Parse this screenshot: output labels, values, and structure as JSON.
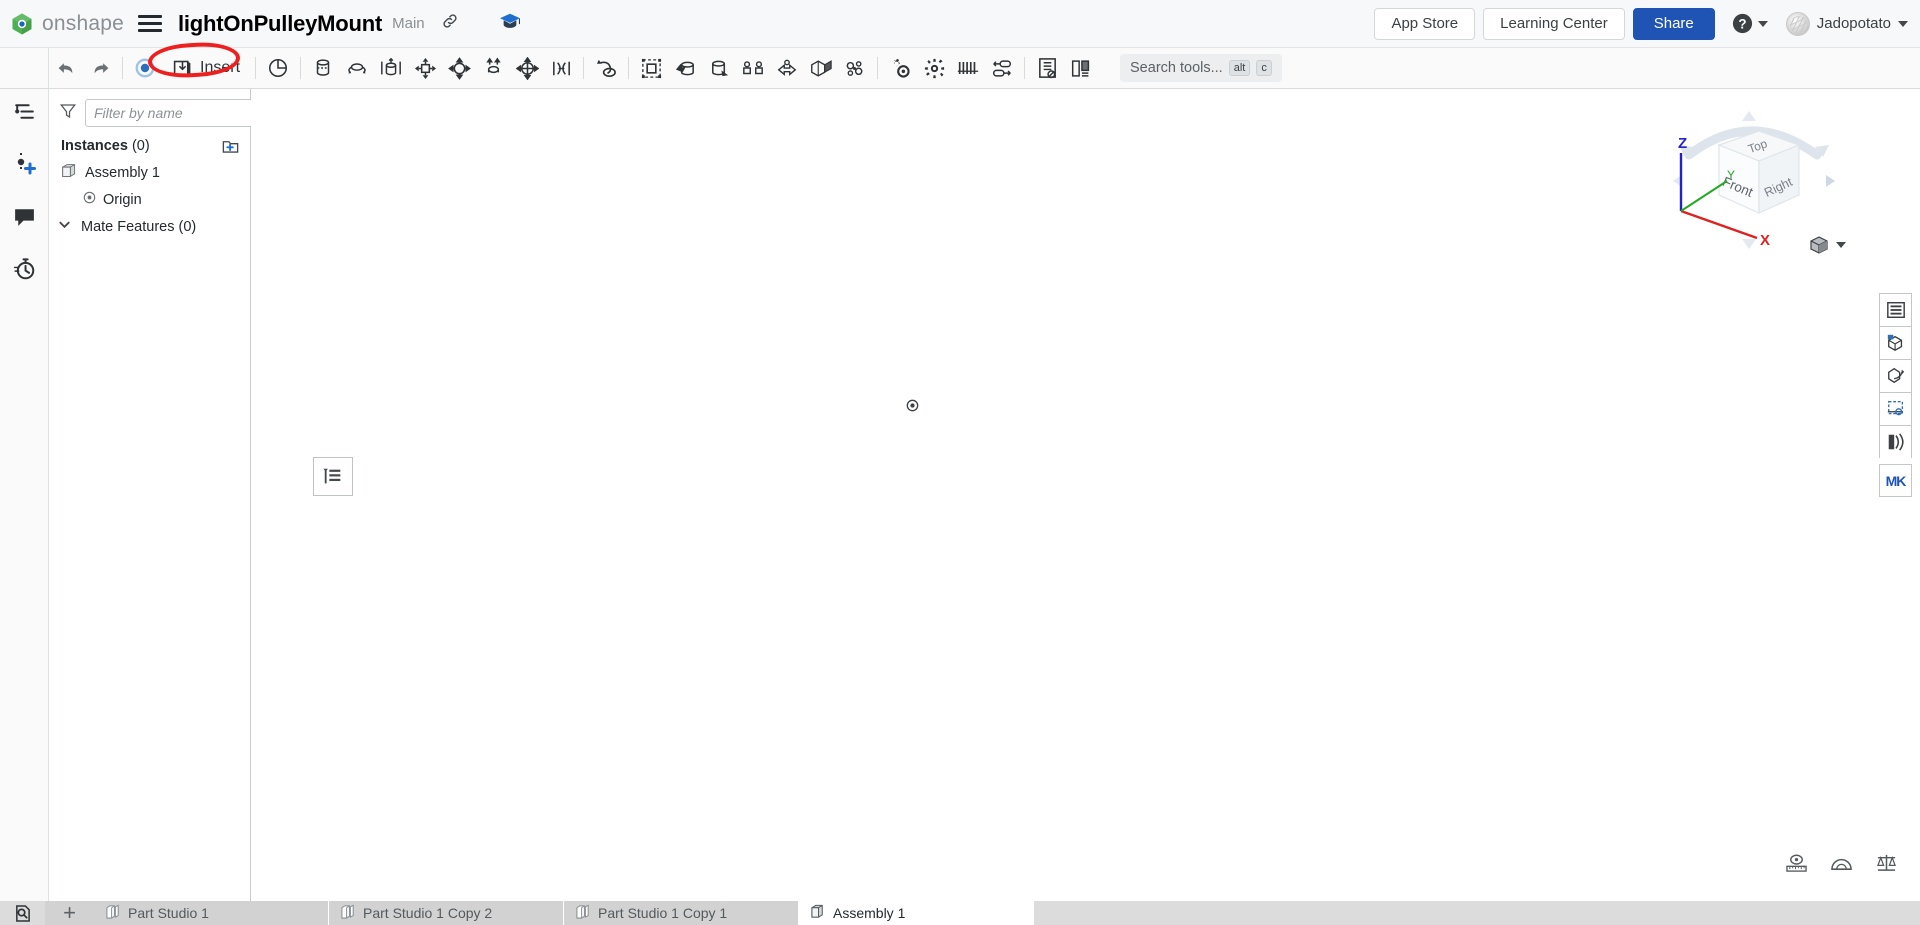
{
  "header": {
    "brand": "onshape",
    "menu_icon": "hamburger-icon",
    "document_title": "lightOnPulleyMount",
    "branch": "Main",
    "link_icon": "link-icon",
    "learning_flag_icon": "graduation-cap-icon",
    "app_store_label": "App Store",
    "learning_center_label": "Learning Center",
    "share_label": "Share",
    "help_icon": "help-circle-icon",
    "username": "Jadopotato"
  },
  "toolbar": {
    "undo_label": "Undo",
    "redo_label": "Redo",
    "insert_label": "Insert",
    "search": {
      "placeholder": "Search tools...",
      "kbd_mod": "alt",
      "kbd_key": "c"
    },
    "tools": [
      {
        "name": "undo-icon",
        "title": "Undo"
      },
      {
        "name": "redo-icon",
        "title": "Redo"
      },
      {
        "name": "assemble-icon",
        "title": "Assemble"
      },
      {
        "name": "insert-icon",
        "title": "Insert"
      },
      {
        "name": "mate-icon",
        "title": "Mate"
      },
      {
        "name": "revolute-mate-icon",
        "title": "Revolute mate"
      },
      {
        "name": "slider-mate-icon",
        "title": "Slider mate"
      },
      {
        "name": "cylindrical-mate-icon",
        "title": "Cylindrical mate"
      },
      {
        "name": "planar-mate-icon",
        "title": "Planar mate"
      },
      {
        "name": "ball-mate-icon",
        "title": "Ball mate"
      },
      {
        "name": "pin-slot-mate-icon",
        "title": "Pin slot mate"
      },
      {
        "name": "parallel-mate-icon",
        "title": "Parallel mate"
      },
      {
        "name": "tangent-mate-icon",
        "title": "Tangent mate"
      },
      {
        "name": "group-icon",
        "title": "Group"
      },
      {
        "name": "fastened-mate-icon",
        "title": "Fastened mate"
      },
      {
        "name": "replicate-icon",
        "title": "Replicate"
      },
      {
        "name": "pattern-icon",
        "title": "Pattern"
      },
      {
        "name": "mirror-icon",
        "title": "Mirror"
      },
      {
        "name": "transform-icon",
        "title": "Transform"
      },
      {
        "name": "explode-icon",
        "title": "Explode"
      },
      {
        "name": "gear-mate-relation-icon",
        "title": "Gear relation"
      },
      {
        "name": "mate-connector-icon",
        "title": "Mate connector"
      },
      {
        "name": "linear-pattern-icon",
        "title": "Linear pattern"
      },
      {
        "name": "configure-icon",
        "title": "Configure"
      },
      {
        "name": "bill-of-materials-icon",
        "title": "Bill of materials"
      },
      {
        "name": "drawing-icon",
        "title": "Insert drawing"
      }
    ]
  },
  "left_rail": [
    {
      "name": "feature-list-icon",
      "label": "Instances list"
    },
    {
      "name": "add-mate-connector-icon",
      "label": "Add mate connector"
    },
    {
      "name": "comments-icon",
      "label": "Comments"
    },
    {
      "name": "history-icon",
      "label": "Version history"
    }
  ],
  "panel": {
    "filter_icon": "filter-icon",
    "filter_placeholder": "Filter by name",
    "filter_value": "",
    "list_view_icon": "list-view-icon",
    "instances_label": "Instances",
    "instances_count": "(0)",
    "add_folder_icon": "add-folder-icon",
    "tree": [
      {
        "name": "assembly-node",
        "icon": "assembly-icon",
        "label": "Assembly 1",
        "indent": 0
      },
      {
        "name": "origin-node",
        "icon": "origin-icon",
        "label": "Origin",
        "indent": 1
      }
    ],
    "mate_features_label": "Mate Features",
    "mate_features_count": "(0)",
    "mate_features_chevron": "chevron-down-icon"
  },
  "viewport": {
    "origin_marker": "origin-point-marker",
    "float_panel_icon": "display-list-icon",
    "view_cube": {
      "top_label": "Top",
      "front_label": "Front",
      "right_label": "Right",
      "axis_z": "Z",
      "axis_y": "Y",
      "axis_x": "X",
      "color_z": "#2222cc",
      "color_y": "#22aa22",
      "color_x": "#dd2222"
    },
    "view_dropdown_icon": "shaded-view-icon",
    "right_tools": [
      {
        "name": "display-states-icon",
        "label": "Display states"
      },
      {
        "name": "exploded-views-icon",
        "label": "Exploded views"
      },
      {
        "name": "section-view-icon",
        "label": "Section view"
      },
      {
        "name": "zoom-to-selection-icon",
        "label": "Zoom to selection"
      },
      {
        "name": "render-icon",
        "label": "Render studio"
      }
    ],
    "mk_badge": "MK",
    "bottom_right_tools": [
      {
        "name": "measure-icon",
        "label": "Measure"
      },
      {
        "name": "angle-icon",
        "label": "Angle"
      },
      {
        "name": "mass-properties-icon",
        "label": "Mass properties"
      }
    ]
  },
  "tabs": {
    "document_icon": "document-search-icon",
    "add_label": "+",
    "items": [
      {
        "name": "tab-part-studio-1",
        "icon": "part-studio-icon",
        "label": "Part Studio 1",
        "active": false
      },
      {
        "name": "tab-part-studio-1-copy-2",
        "icon": "part-studio-icon",
        "label": "Part Studio 1 Copy 2",
        "active": false
      },
      {
        "name": "tab-part-studio-1-copy-1",
        "icon": "part-studio-icon",
        "label": "Part Studio 1 Copy 1",
        "active": false
      },
      {
        "name": "tab-assembly-1",
        "icon": "assembly-icon",
        "label": "Assembly 1",
        "active": true
      }
    ]
  },
  "annotation": {
    "shape": "red-ellipse-highlight",
    "target": "Insert",
    "color": "#f01f1f"
  }
}
